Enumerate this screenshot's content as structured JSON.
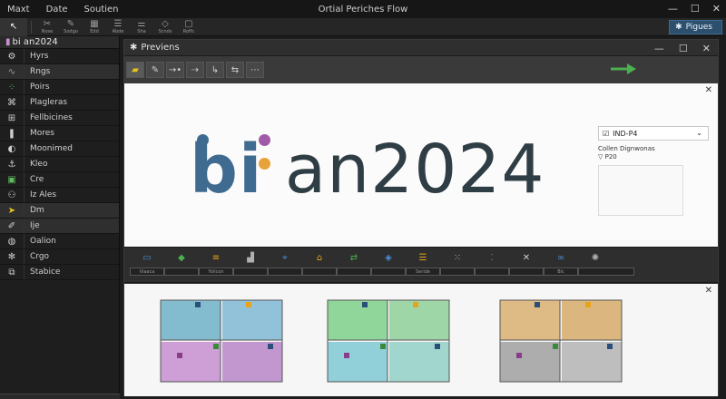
{
  "titlebar": {
    "menu": [
      "Maxt",
      "Date",
      "Soutien"
    ],
    "title": "Ortial Periches Flow",
    "controls": [
      "—",
      "☐",
      "✕"
    ]
  },
  "toolbar": {
    "buttons": [
      {
        "icon": "pointer-icon",
        "glyph": "↖",
        "label": ""
      },
      {
        "icon": "crop-icon",
        "glyph": "✂",
        "label": "Nose"
      },
      {
        "icon": "pen-icon",
        "glyph": "✎",
        "label": "Sodgo"
      },
      {
        "icon": "grid-icon",
        "glyph": "▦",
        "label": "Edd"
      },
      {
        "icon": "align-icon",
        "glyph": "☰",
        "label": "Abde"
      },
      {
        "icon": "sliders-icon",
        "glyph": "⚌",
        "label": "Sha"
      },
      {
        "icon": "diamond-icon",
        "glyph": "◇",
        "label": "Scnds"
      },
      {
        "icon": "frame-icon",
        "glyph": "▢",
        "label": "Roffc"
      }
    ],
    "panels_label": "Pigues"
  },
  "sidebar": {
    "header": "bi an2024",
    "items": [
      {
        "label": "Hyrs",
        "icon": "gear-icon",
        "glyph": "⚙",
        "color": "#d0d0d0"
      },
      {
        "label": "Rngs",
        "icon": "wave-icon",
        "glyph": "∿",
        "color": "#9a9a9a"
      },
      {
        "label": "Poirs",
        "icon": "points-icon",
        "glyph": "⁘",
        "color": "#5fbf5f"
      },
      {
        "label": "Plagleras",
        "icon": "network-icon",
        "glyph": "⌘",
        "color": "#cfcfcf"
      },
      {
        "label": "Fellbicines",
        "icon": "hierarchy-icon",
        "glyph": "⊞",
        "color": "#cfcfcf"
      },
      {
        "label": "Mores",
        "icon": "layers-icon",
        "glyph": "❚",
        "color": "#cfcfcf"
      },
      {
        "label": "Moonimed",
        "icon": "moon-icon",
        "glyph": "◐",
        "color": "#cfcfcf"
      },
      {
        "label": "Kleo",
        "icon": "anchor-icon",
        "glyph": "⚓",
        "color": "#cfcfcf"
      },
      {
        "label": "Cre",
        "icon": "create-icon",
        "glyph": "▣",
        "color": "#5fbf5f"
      },
      {
        "label": "Iz Ales",
        "icon": "user-icon",
        "glyph": "⚇",
        "color": "#cfcfcf"
      },
      {
        "label": "Dm",
        "icon": "cursor-icon",
        "glyph": "➤",
        "color": "#e8c21a"
      },
      {
        "label": "Ije",
        "icon": "brush-icon",
        "glyph": "✐",
        "color": "#cfcfcf"
      },
      {
        "label": "Oalion",
        "icon": "globe-icon",
        "glyph": "◍",
        "color": "#cfcfcf"
      },
      {
        "label": "Crgo",
        "icon": "sparkle-icon",
        "glyph": "✻",
        "color": "#cfcfcf"
      },
      {
        "label": "Stabice",
        "icon": "connector-icon",
        "glyph": "⧉",
        "color": "#cfcfcf"
      }
    ]
  },
  "preview": {
    "title": "Previens",
    "controls": [
      "—",
      "☐",
      "✕"
    ],
    "tools": [
      "▰",
      "✎",
      "→•",
      "⇢",
      "↳",
      "⇆",
      "⋯"
    ],
    "canvas_close": "✕",
    "logo_bi": "bi",
    "logo_rest": " an2024",
    "dot_colors": {
      "blue": "#3e6b8f",
      "purple": "#a05aa8",
      "orange": "#e8a23a"
    },
    "dropdown_value": "IND-P4",
    "info_title": "Collen Dignwonas",
    "info_sub": "▽ P20",
    "lower_close": "✕"
  },
  "strip": {
    "icons": [
      {
        "icon": "panel-icon",
        "glyph": "▭",
        "color": "#4a90d9"
      },
      {
        "icon": "leaf-icon",
        "glyph": "◆",
        "color": "#4caf50"
      },
      {
        "icon": "stack-icon",
        "glyph": "≡",
        "color": "#e8a31a"
      },
      {
        "icon": "chart-icon",
        "glyph": "▟",
        "color": "#b0b0b0"
      },
      {
        "icon": "pin-icon",
        "glyph": "⌖",
        "color": "#4a90d9"
      },
      {
        "icon": "house-icon",
        "glyph": "⌂",
        "color": "#e8a31a"
      },
      {
        "icon": "swap-icon",
        "glyph": "⇄",
        "color": "#4caf50"
      },
      {
        "icon": "diamond-icon",
        "glyph": "◈",
        "color": "#4a90d9"
      },
      {
        "icon": "list-icon",
        "glyph": "☰",
        "color": "#e8a31a"
      },
      {
        "icon": "scatter-icon",
        "glyph": "⁙",
        "color": "#b0b0b0"
      },
      {
        "icon": "grid-dots-icon",
        "glyph": "⁚",
        "color": "#4a90d9"
      },
      {
        "icon": "close-icon",
        "glyph": "✕",
        "color": "#d0d0d0"
      },
      {
        "icon": "link-icon",
        "glyph": "∞",
        "color": "#4a90d9"
      },
      {
        "icon": "sparkle-icon",
        "glyph": "✺",
        "color": "#b0b0b0"
      }
    ],
    "fields": [
      "Viaaca",
      "",
      "Yolicon",
      "",
      "",
      "",
      "",
      "",
      "Seride",
      "",
      "",
      "",
      "Bic",
      ""
    ]
  },
  "plans": [
    {
      "name": "plan-blue-purple",
      "colors": [
        "#6eb0c8",
        "#7fb8d4",
        "#c78fd0",
        "#b986c9"
      ]
    },
    {
      "name": "plan-green-cyan",
      "colors": [
        "#7ed08a",
        "#8fd09a",
        "#7fc8d4",
        "#92d0c8"
      ]
    },
    {
      "name": "plan-tan-grey",
      "colors": [
        "#d9b070",
        "#d6ac6a",
        "#a0a0a0",
        "#b4b4b4"
      ]
    }
  ]
}
